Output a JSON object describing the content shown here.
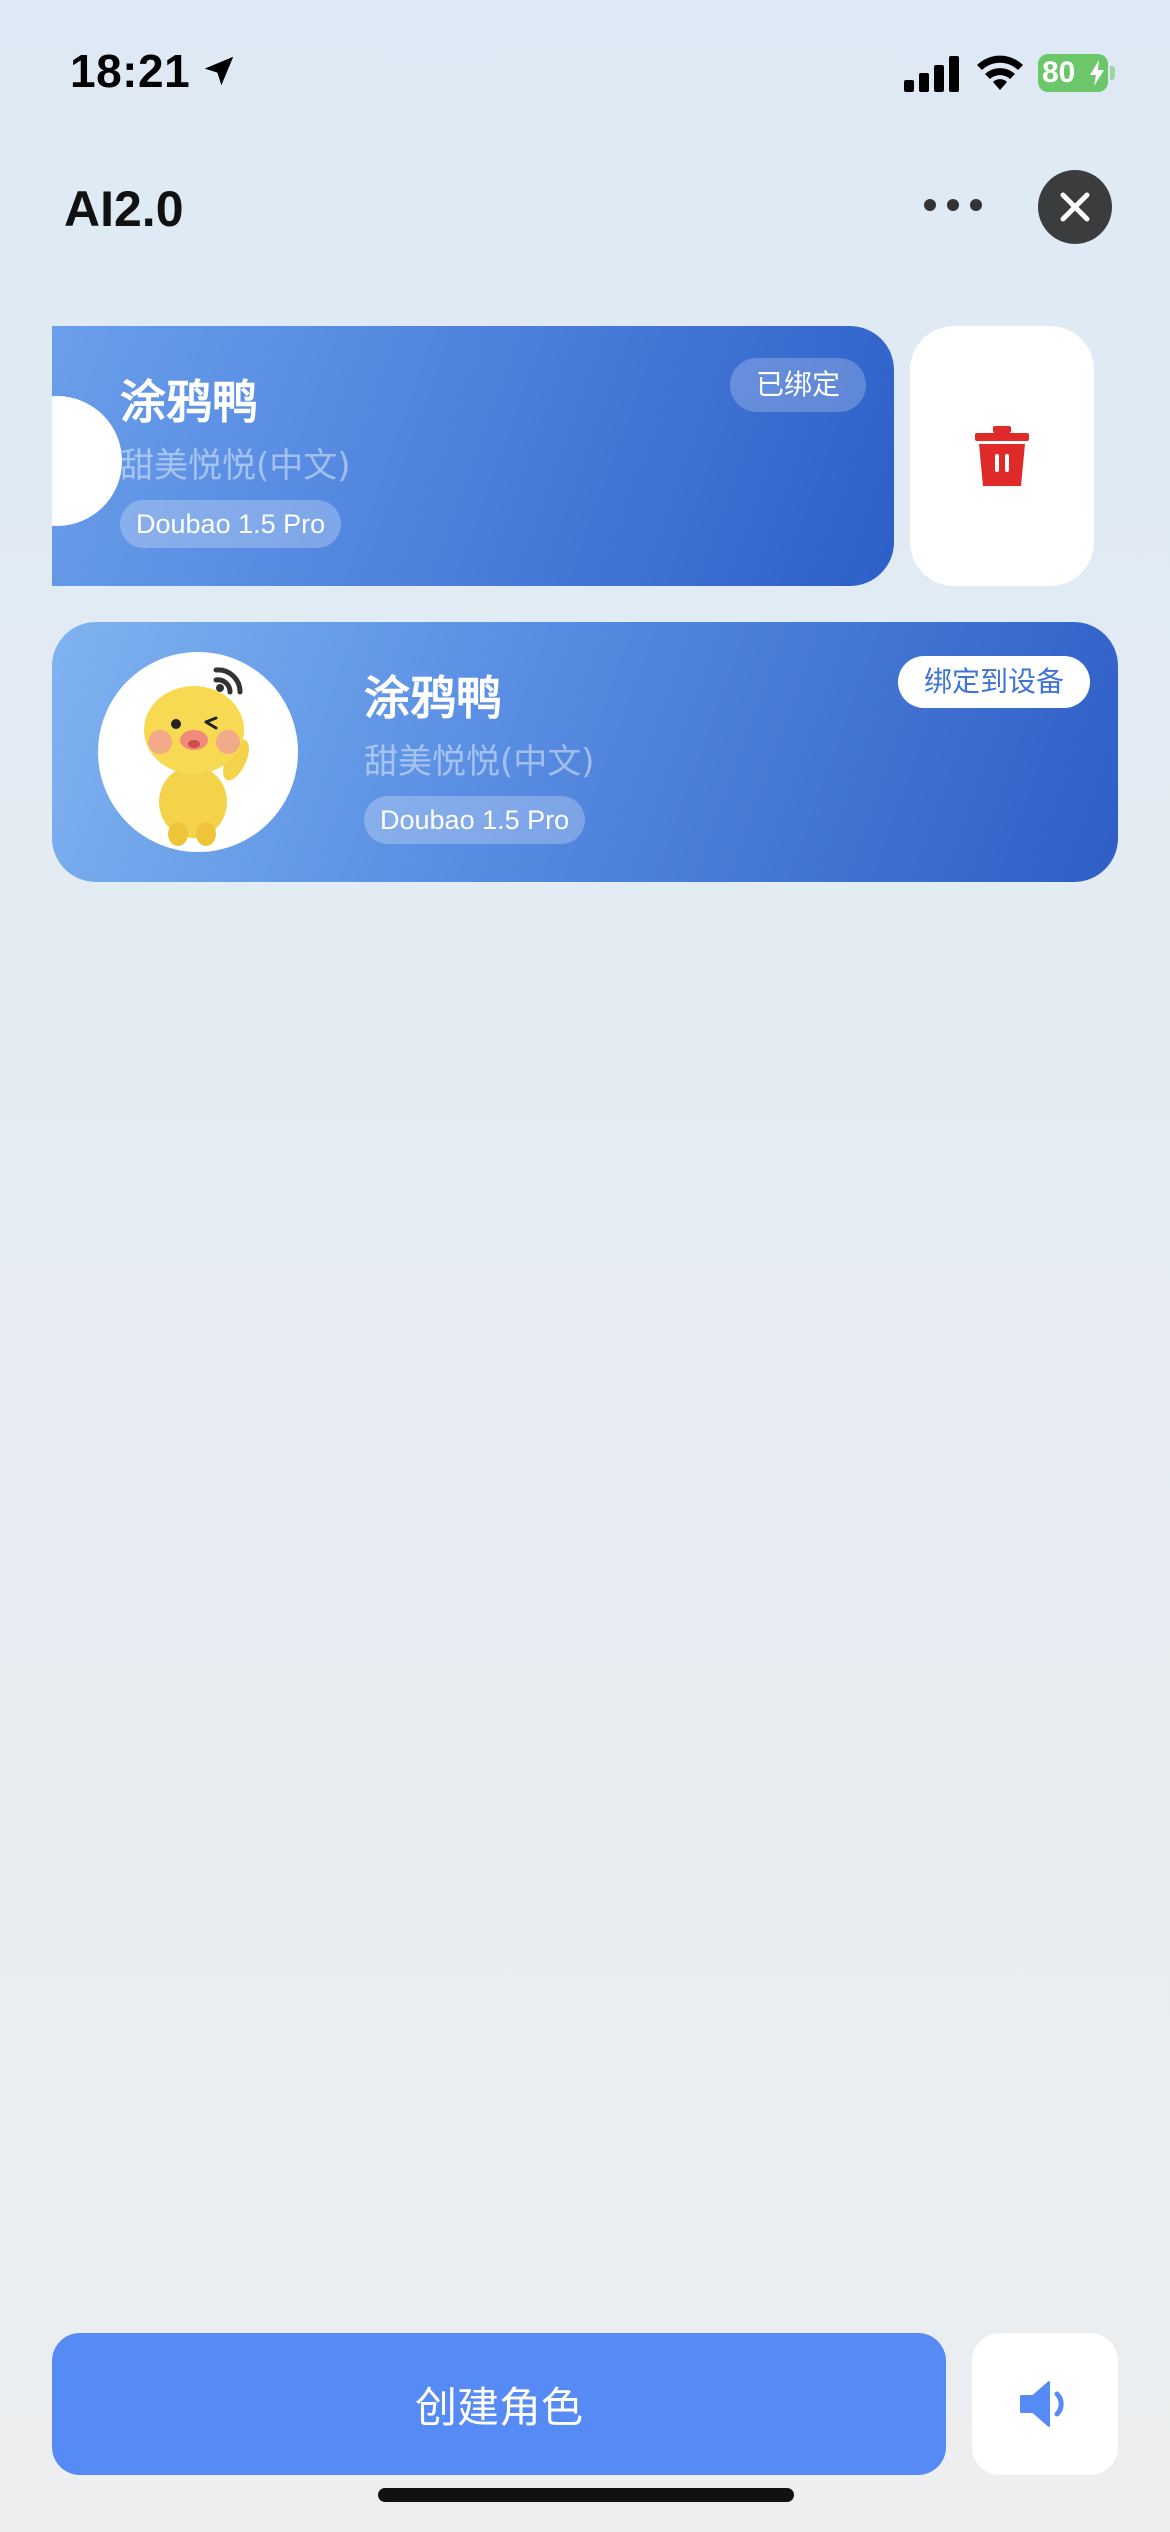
{
  "status_bar": {
    "time": "18:21",
    "battery_level": "80",
    "icons": [
      "location-arrow-icon",
      "cellular-signal-icon",
      "wifi-icon",
      "battery-charging-icon"
    ]
  },
  "header": {
    "title": "AI2.0",
    "more_icon": "ellipsis-icon",
    "close_icon": "close-icon"
  },
  "roles": [
    {
      "name": "涂鸦鸭",
      "voice": "甜美悦悦(中文)",
      "model": "Doubao 1.5 Pro",
      "status_label": "已绑定",
      "swiped": true
    },
    {
      "name": "涂鸦鸭",
      "voice": "甜美悦悦(中文)",
      "model": "Doubao 1.5 Pro",
      "action_label": "绑定到设备",
      "swiped": false
    }
  ],
  "delete_action": {
    "icon": "trash-icon",
    "color": "#e02a2a"
  },
  "footer": {
    "create_label": "创建角色",
    "speaker_icon": "speaker-icon"
  },
  "colors": {
    "accent": "#568af4",
    "card_gradient_start": "#7fb3f0",
    "card_gradient_end": "#2f5ec6",
    "bind_text": "#3f73d8"
  }
}
